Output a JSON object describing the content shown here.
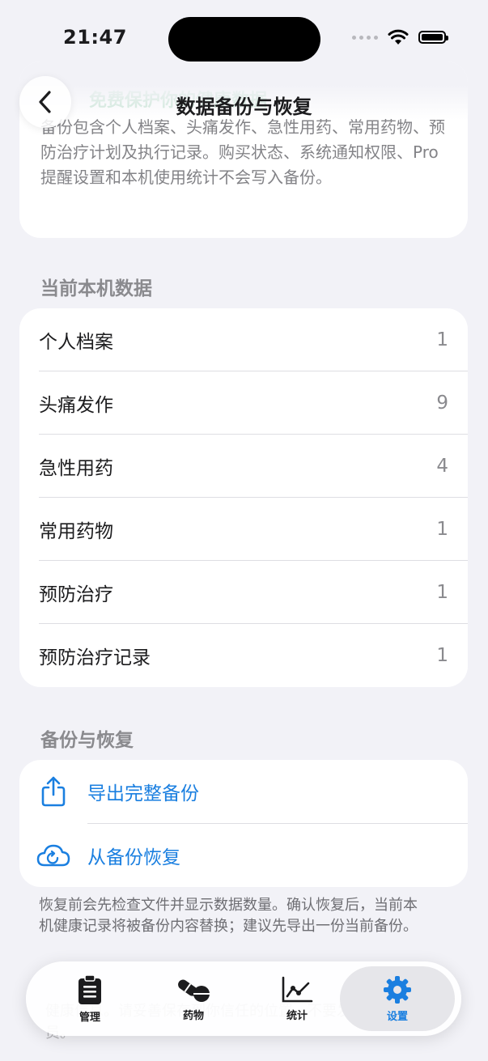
{
  "status": {
    "time": "21:47"
  },
  "nav": {
    "title": "数据备份与恢复"
  },
  "intro": {
    "title": "免费保护你的健康数据",
    "text": "备份包含个人档案、头痛发作、急性用药、常用药物、预防治疗计划及执行记录。购买状态、系统通知权限、Pro 提醒设置和本机使用统计不会写入备份。"
  },
  "local_data": {
    "header": "当前本机数据",
    "rows": [
      {
        "label": "个人档案",
        "value": "1"
      },
      {
        "label": "头痛发作",
        "value": "9"
      },
      {
        "label": "急性用药",
        "value": "4"
      },
      {
        "label": "常用药物",
        "value": "1"
      },
      {
        "label": "预防治疗",
        "value": "1"
      },
      {
        "label": "预防治疗记录",
        "value": "1"
      }
    ]
  },
  "backup": {
    "header": "备份与恢复",
    "export_label": "导出完整备份",
    "restore_label": "从备份恢复",
    "export_icon": "share-icon",
    "restore_icon": "cloud-restore-icon"
  },
  "footnote": "恢复前会先检查文件并显示数据数量。确认恢复后，当前本机健康记录将被备份内容替换；建议先导出一份当前备份。",
  "footnote_hidden": "健康信息。请妥善保存到你信任的位置，不要发送给无关人员。",
  "tabs": [
    {
      "label": "管理",
      "icon": "clipboard-icon"
    },
    {
      "label": "药物",
      "icon": "pills-icon"
    },
    {
      "label": "统计",
      "icon": "chart-icon"
    },
    {
      "label": "设置",
      "icon": "gear-icon"
    }
  ],
  "colors": {
    "accent": "#1a7fe0",
    "green": "#2e9e5a",
    "background": "#f2f2f7"
  }
}
